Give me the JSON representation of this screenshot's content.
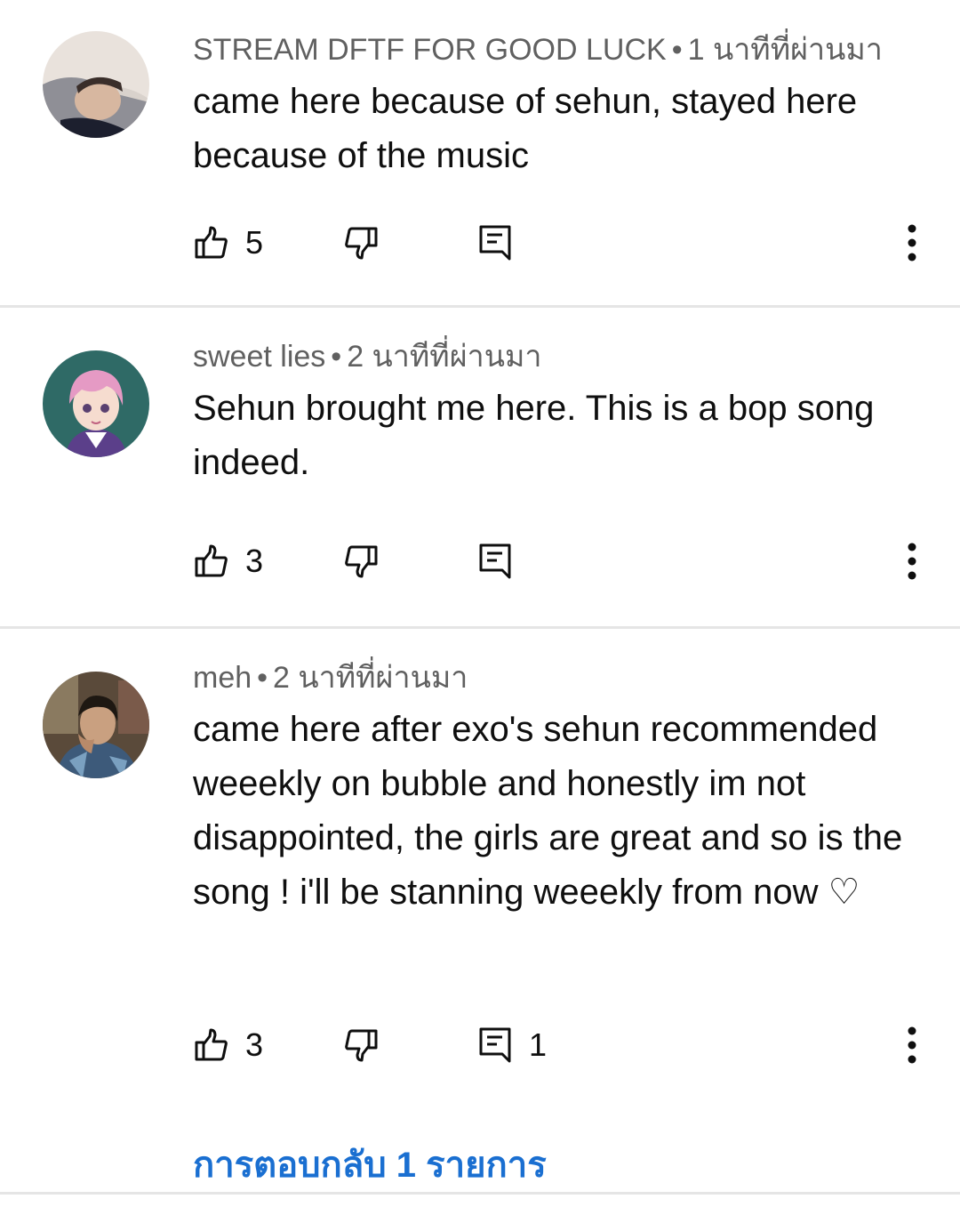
{
  "comments": [
    {
      "author": "STREAM DFTF FOR GOOD LUCK",
      "separator": "•",
      "time": "1 นาทีที่ผ่านมา",
      "text": "came here because of sehun, stayed here because of the music",
      "likes": "5",
      "replies": ""
    },
    {
      "author": "sweet lies",
      "separator": "•",
      "time": "2 นาทีที่ผ่านมา",
      "text": "Sehun brought me here. This is a bop  song indeed.",
      "likes": "3",
      "replies": ""
    },
    {
      "author": "meh",
      "separator": "•",
      "time": "2 นาทีที่ผ่านมา",
      "text": "came here after exo's sehun recommended weeekly on bubble and honestly im not disappointed, the girls are great and so is the song ! i'll be stanning weeekly from now ♡",
      "likes": "3",
      "replies": "1"
    }
  ],
  "view_replies": "การตอบกลับ 1 รายการ",
  "icons": {
    "like": "thumbs-up-icon",
    "dislike": "thumbs-down-icon",
    "reply": "reply-comment-icon",
    "more": "more-vertical-icon"
  },
  "colors": {
    "meta_text": "#606060",
    "link_blue": "#1a6fd1",
    "divider": "#e5e5e5"
  }
}
